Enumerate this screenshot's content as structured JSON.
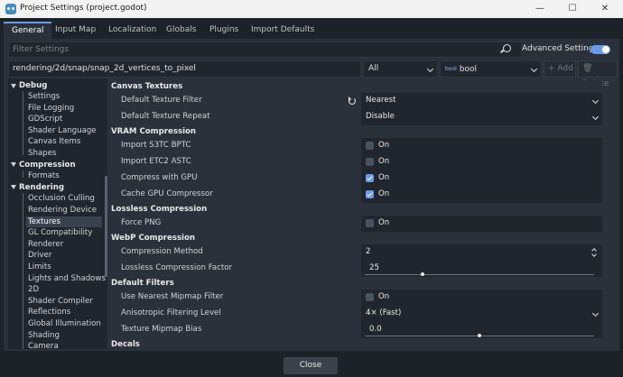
{
  "window": {
    "title": "Project Settings (project.godot)",
    "minimize_glyph": "—",
    "maximize_glyph": "☐",
    "close_glyph": "✕"
  },
  "tabs": [
    {
      "label": "General",
      "active": true
    },
    {
      "label": "Input Map"
    },
    {
      "label": "Localization"
    },
    {
      "label": "Globals"
    },
    {
      "label": "Plugins"
    },
    {
      "label": "Import Defaults"
    }
  ],
  "toolbar": {
    "filter_placeholder": "Filter Settings",
    "advanced_label": "Advanced Settings",
    "advanced_on": true,
    "property_path": "rendering/2d/snap/snap_2d_vertices_to_pixel",
    "feature_select": "All",
    "type_icon_text": "bool",
    "type_select": "bool",
    "add_label": "+ Add",
    "delete_label": "🗑 Delete"
  },
  "tree": [
    {
      "label": "Debug",
      "cat": true
    },
    {
      "label": "Settings"
    },
    {
      "label": "File Logging"
    },
    {
      "label": "GDScript"
    },
    {
      "label": "Shader Language"
    },
    {
      "label": "Canvas Items"
    },
    {
      "label": "Shapes"
    },
    {
      "label": "Compression",
      "cat": true
    },
    {
      "label": "Formats"
    },
    {
      "label": "Rendering",
      "cat": true
    },
    {
      "label": "Occlusion Culling"
    },
    {
      "label": "Rendering Device"
    },
    {
      "label": "Textures",
      "selected": true
    },
    {
      "label": "GL Compatibility"
    },
    {
      "label": "Renderer"
    },
    {
      "label": "Driver"
    },
    {
      "label": "Limits"
    },
    {
      "label": "Lights and Shadows"
    },
    {
      "label": "2D"
    },
    {
      "label": "Shader Compiler"
    },
    {
      "label": "Reflections"
    },
    {
      "label": "Global Illumination"
    },
    {
      "label": "Shading"
    },
    {
      "label": "Camera"
    }
  ],
  "inspector": {
    "sections": {
      "canvas_textures": "Canvas Textures",
      "vram": "VRAM Compression",
      "lossless": "Lossless Compression",
      "webp": "WebP Compression",
      "default_filters": "Default Filters",
      "decals": "Decals"
    },
    "props": {
      "default_texture_filter": {
        "label": "Default Texture Filter",
        "value": "Nearest"
      },
      "default_texture_repeat": {
        "label": "Default Texture Repeat",
        "value": "Disable"
      },
      "import_s3tc_bptc": {
        "label": "Import S3TC BPTC",
        "value": "On",
        "checked": false
      },
      "import_etc2_astc": {
        "label": "Import ETC2 ASTC",
        "value": "On",
        "checked": false
      },
      "compress_with_gpu": {
        "label": "Compress with GPU",
        "value": "On",
        "checked": true
      },
      "cache_gpu_compressor": {
        "label": "Cache GPU Compressor",
        "value": "On",
        "checked": true
      },
      "force_png": {
        "label": "Force PNG",
        "value": "On",
        "checked": false
      },
      "compression_method": {
        "label": "Compression Method",
        "value": "2"
      },
      "lossless_compression_factor": {
        "label": "Lossless Compression Factor",
        "value": "25",
        "fraction": 0.25
      },
      "use_nearest_mipmap_filter": {
        "label": "Use Nearest Mipmap Filter",
        "value": "On",
        "checked": false
      },
      "anisotropic_filtering_level": {
        "label": "Anisotropic Filtering Level",
        "value": "4× (Fast)"
      },
      "texture_mipmap_bias": {
        "label": "Texture Mipmap Bias",
        "value": "0.0",
        "fraction": 0.5
      }
    }
  },
  "footer": {
    "close_label": "Close"
  },
  "colors": {
    "accent": "#699ce8",
    "panel": "#2b313b",
    "field": "#21262e",
    "background": "#1d2229"
  }
}
